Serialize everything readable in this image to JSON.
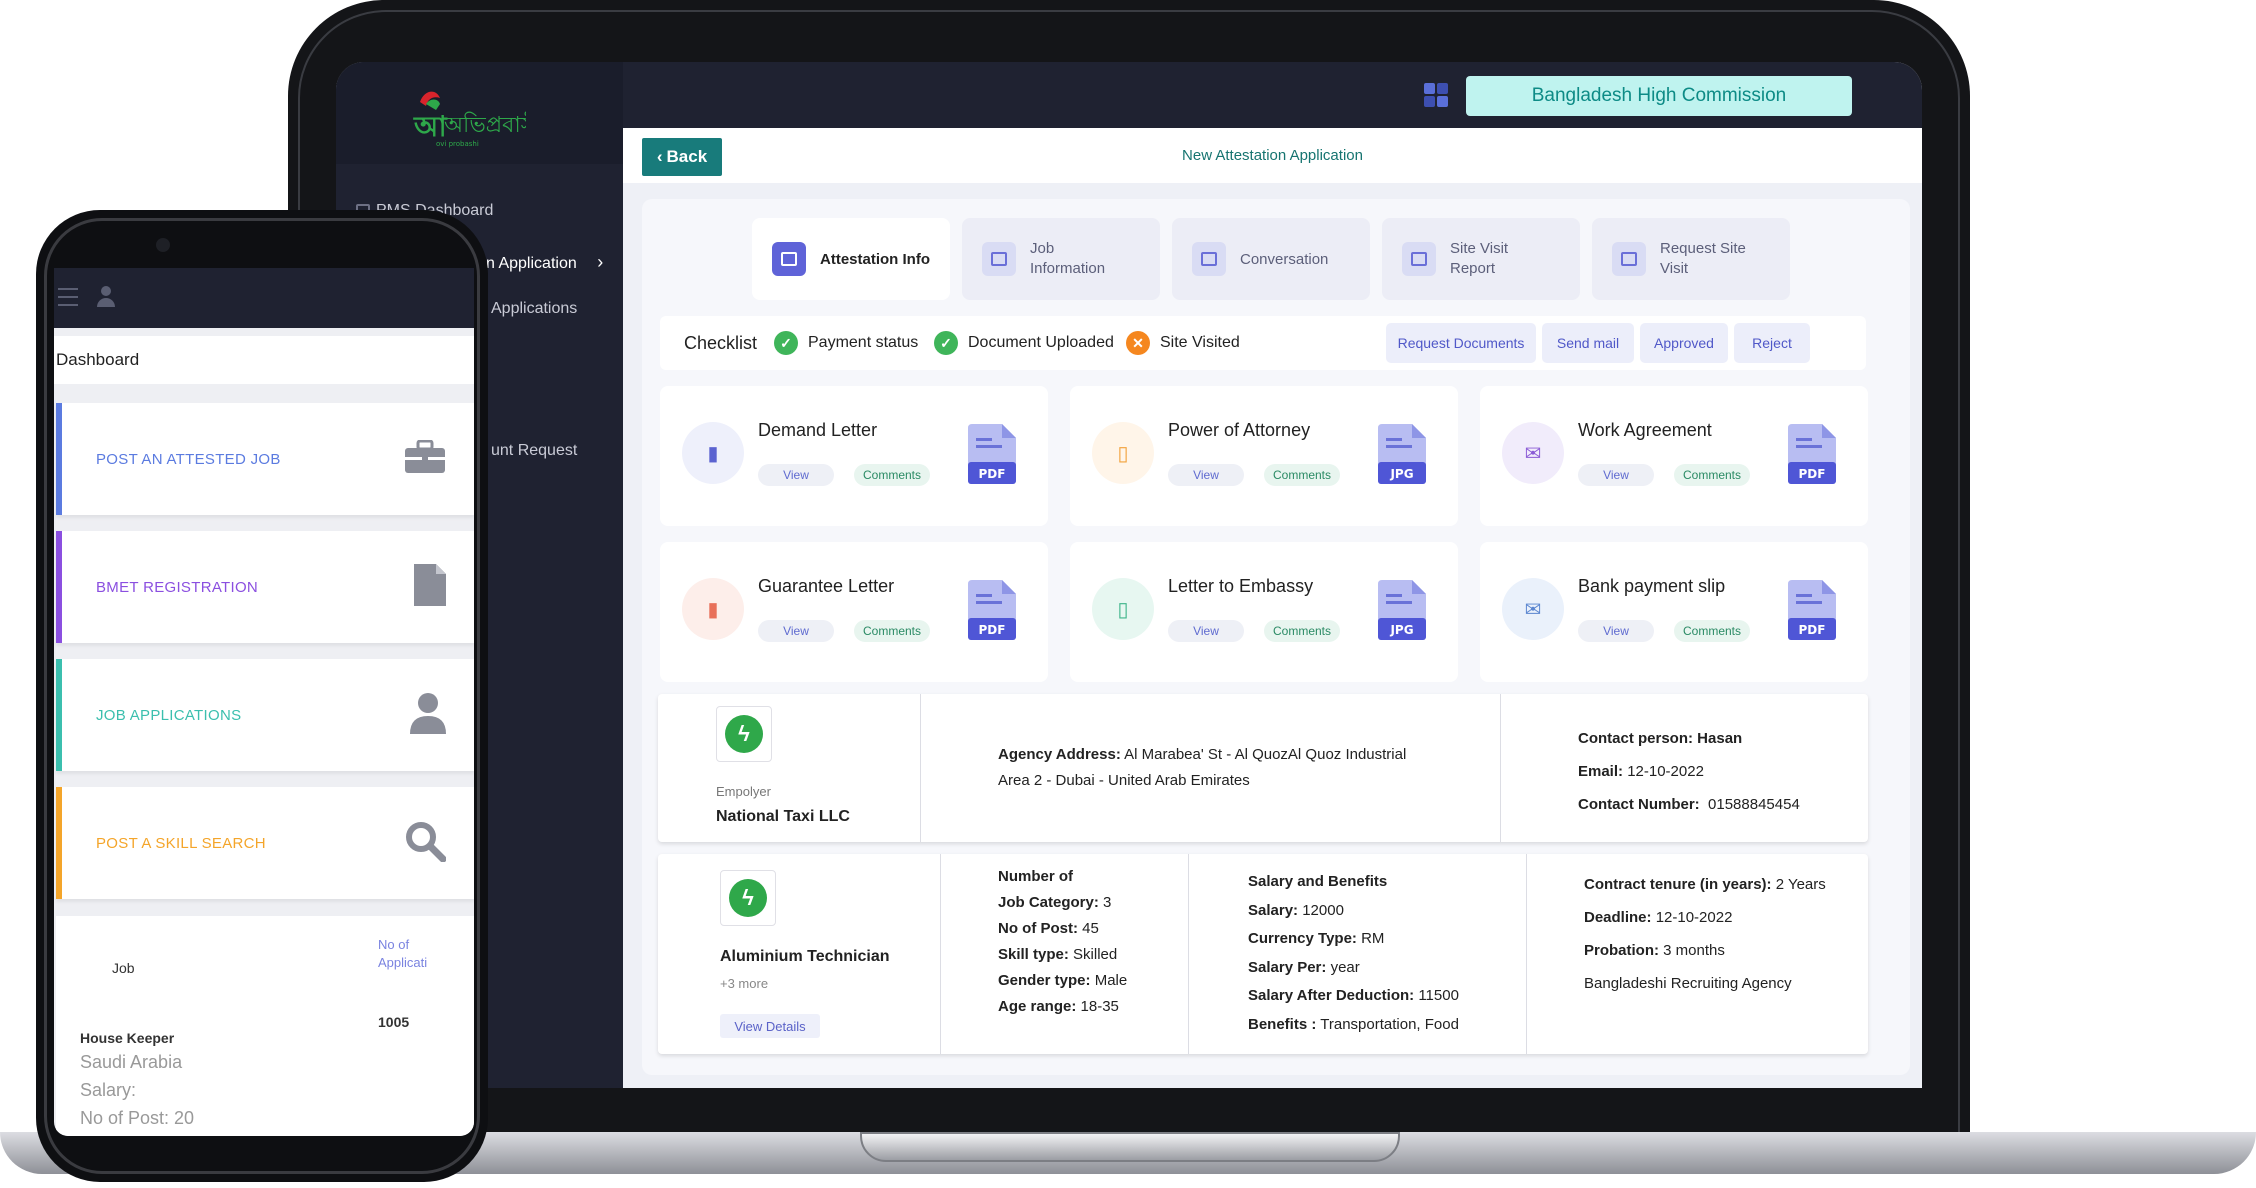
{
  "app": {
    "logo_text": "অভিপ্রবাসী",
    "logo_sub": "ovi probashi"
  },
  "sidebar": {
    "items": [
      {
        "label": "Dashboard",
        "visible_text": "PMS Dashboard"
      },
      {
        "label": "n Application"
      },
      {
        "label": "Applications"
      },
      {
        "label": "unt Request"
      }
    ]
  },
  "topbar": {
    "org_badge": "Bangladesh High Commission"
  },
  "header": {
    "back_label": "Back",
    "title": "New Attestation Application"
  },
  "tabs": [
    {
      "label": "Attestation Info",
      "active": true
    },
    {
      "label": "Job\nInformation"
    },
    {
      "label": "Conversation"
    },
    {
      "label": "Site Visit\nReport"
    },
    {
      "label": "Request Site\nVisit"
    }
  ],
  "checklist": {
    "title": "Checklist",
    "items": [
      {
        "label": "Payment status",
        "state": "done",
        "color": "#3fb55a"
      },
      {
        "label": "Document Uploaded",
        "state": "done",
        "color": "#3fb55a"
      },
      {
        "label": "Site Visited",
        "state": "failed",
        "color": "#f5871f"
      }
    ],
    "actions": [
      "Request Documents",
      "Send mail",
      "Approved",
      "Reject"
    ]
  },
  "documents": [
    {
      "title": "Demand Letter",
      "view": "View",
      "comments": "Comments",
      "file_type": "PDF",
      "icon": "bar-chart-icon",
      "tint": "#eef0fb",
      "fg": "#5b63d0"
    },
    {
      "title": "Power of Attorney",
      "view": "View",
      "comments": "Comments",
      "file_type": "JPG",
      "icon": "file-icon",
      "tint": "#fff5e9",
      "fg": "#f2a23c"
    },
    {
      "title": "Work Agreement",
      "view": "View",
      "comments": "Comments",
      "file_type": "PDF",
      "icon": "mail-icon",
      "tint": "#f1ecfb",
      "fg": "#8b5cd6"
    },
    {
      "title": "Guarantee Letter",
      "view": "View",
      "comments": "Comments",
      "file_type": "PDF",
      "icon": "bar-chart-icon",
      "tint": "#fdeeea",
      "fg": "#e8705a"
    },
    {
      "title": "Letter to Embassy",
      "view": "View",
      "comments": "Comments",
      "file_type": "JPG",
      "icon": "file-icon",
      "tint": "#e7f7f1",
      "fg": "#3fb58a"
    },
    {
      "title": "Bank payment slip",
      "view": "View",
      "comments": "Comments",
      "file_type": "PDF",
      "icon": "mail-icon",
      "tint": "#eaf1fb",
      "fg": "#5b86d0"
    }
  ],
  "employer": {
    "caption": "Empolyer",
    "name": "National Taxi LLC",
    "address_label": "Agency Address:",
    "address_line1": "Al Marabea' St - Al QuozAl Quoz Industrial",
    "address_line2": "Area 2 - Dubai - United Arab Emirates",
    "contact_person": "Contact person: Hasan",
    "email_label": "Email:",
    "email_value": "12-10-2022",
    "contact_number_label": "Contact Number:",
    "contact_number_value": "01588845454"
  },
  "job": {
    "title": "Aluminium Technician",
    "more": "+3 more",
    "view_details": "View Details",
    "col1": [
      {
        "label": "Number of",
        "value": ""
      },
      {
        "label": "Job Category:",
        "value": "3"
      },
      {
        "label": "No of Post:",
        "value": "45"
      },
      {
        "label": "Skill type:",
        "value": "Skilled"
      },
      {
        "label": "Gender type:",
        "value": "Male"
      },
      {
        "label": "Age range:",
        "value": "18-35"
      }
    ],
    "col2": [
      {
        "label": "Salary and Benefits",
        "value": ""
      },
      {
        "label": "Salary:",
        "value": "12000"
      },
      {
        "label": "Currency Type:",
        "value": "RM"
      },
      {
        "label": "Salary Per:",
        "value": "year"
      },
      {
        "label": "Salary After Deduction:",
        "value": "11500"
      },
      {
        "label": "Benefits :",
        "value": "Transportation, Food"
      }
    ],
    "col3": [
      {
        "label": "Contract tenure (in years):",
        "value": "2 Years"
      },
      {
        "label": "Deadline:",
        "value": "12-10-2022"
      },
      {
        "label": "Probation:",
        "value": "3 months"
      },
      {
        "label": "",
        "value": "Bangladeshi Recruiting Agency"
      }
    ]
  },
  "phone": {
    "title": "Dashboard",
    "cards": [
      {
        "label": "POST AN ATTESTED JOB",
        "color": "#5b7be0",
        "icon": "briefcase-icon"
      },
      {
        "label": "BMET REGISTRATION",
        "color": "#8b4fe0",
        "icon": "document-icon"
      },
      {
        "label": "JOB APPLICATIONS",
        "color": "#3bbfae",
        "icon": "user-icon"
      },
      {
        "label": "POST A SKILL SEARCH",
        "color": "#f4a52a",
        "icon": "search-icon"
      }
    ],
    "table": {
      "col_job": "Job",
      "col_apps_line1": "No of",
      "col_apps_line2": "Applicati",
      "row_job": "House Keeper",
      "row_count": "1005",
      "row_country": "Saudi Arabia",
      "row_salary": "Salary:",
      "row_posts": "No of Post: 20"
    }
  }
}
